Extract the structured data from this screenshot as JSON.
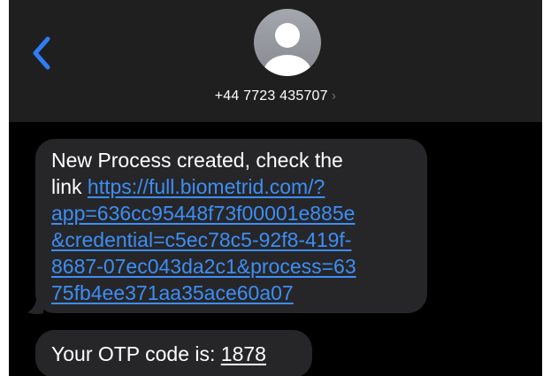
{
  "header": {
    "contact_number": "+44 7723 435707",
    "chevron": "›",
    "back_icon": "chevron-left-icon",
    "avatar_icon": "person-icon"
  },
  "messages": [
    {
      "text_lines": [
        "New Process created, check the",
        "link "
      ],
      "link_lines": [
        "https://full.biometrid.com/?",
        "app=636cc95448f73f00001e885e",
        "&credential=c5ec78c5-92f8-419f-",
        "8687-07ec043da2c1&process=63",
        "75fb4ee371aa35ace60a07"
      ]
    },
    {
      "prefix": "Your OTP code is: ",
      "code": "1878"
    }
  ],
  "colors": {
    "header_bg": "#1f1f1f",
    "bubble_bg": "#262628",
    "link": "#3d8ef5",
    "back": "#2f7df6"
  }
}
